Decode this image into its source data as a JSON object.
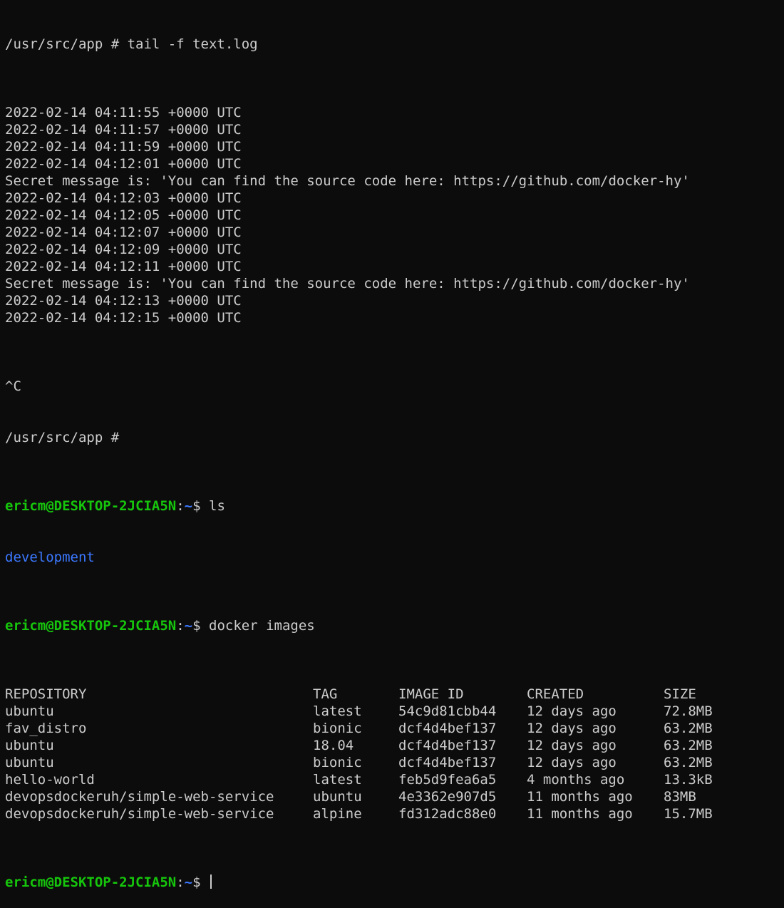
{
  "session_1": {
    "prompt": "/usr/src/app # ",
    "command": "tail -f text.log"
  },
  "log_lines": [
    "2022-02-14 04:11:55 +0000 UTC",
    "2022-02-14 04:11:57 +0000 UTC",
    "2022-02-14 04:11:59 +0000 UTC",
    "2022-02-14 04:12:01 +0000 UTC",
    "Secret message is: 'You can find the source code here: https://github.com/docker-hy'",
    "2022-02-14 04:12:03 +0000 UTC",
    "2022-02-14 04:12:05 +0000 UTC",
    "2022-02-14 04:12:07 +0000 UTC",
    "2022-02-14 04:12:09 +0000 UTC",
    "2022-02-14 04:12:11 +0000 UTC",
    "Secret message is: 'You can find the source code here: https://github.com/docker-hy'",
    "2022-02-14 04:12:13 +0000 UTC",
    "2022-02-14 04:12:15 +0000 UTC"
  ],
  "interrupt": "^C",
  "session_1_end_prompt": "/usr/src/app #",
  "host_prompt": {
    "user_host": "ericm@DESKTOP-2JCIA5N",
    "sep": ":",
    "path": "~",
    "dollar": "$ "
  },
  "ls": {
    "command": "ls",
    "output": "development"
  },
  "docker": {
    "command": "docker images",
    "headers": [
      "REPOSITORY",
      "TAG",
      "IMAGE ID",
      "CREATED",
      "SIZE"
    ],
    "rows": [
      [
        "ubuntu",
        "latest",
        "54c9d81cbb44",
        "12 days ago",
        "72.8MB"
      ],
      [
        "fav_distro",
        "bionic",
        "dcf4d4bef137",
        "12 days ago",
        "63.2MB"
      ],
      [
        "ubuntu",
        "18.04",
        "dcf4d4bef137",
        "12 days ago",
        "63.2MB"
      ],
      [
        "ubuntu",
        "bionic",
        "dcf4d4bef137",
        "12 days ago",
        "63.2MB"
      ],
      [
        "hello-world",
        "latest",
        "feb5d9fea6a5",
        "4 months ago",
        "13.3kB"
      ],
      [
        "devopsdockeruh/simple-web-service",
        "ubuntu",
        "4e3362e907d5",
        "11 months ago",
        "83MB"
      ],
      [
        "devopsdockeruh/simple-web-service",
        "alpine",
        "fd312adc88e0",
        "11 months ago",
        "15.7MB"
      ]
    ]
  },
  "colors": {
    "background": "#0c0c0c",
    "text": "#cccccc",
    "prompt_user": "#16c60c",
    "prompt_path": "#3b78ff",
    "directory": "#3b78ff"
  }
}
